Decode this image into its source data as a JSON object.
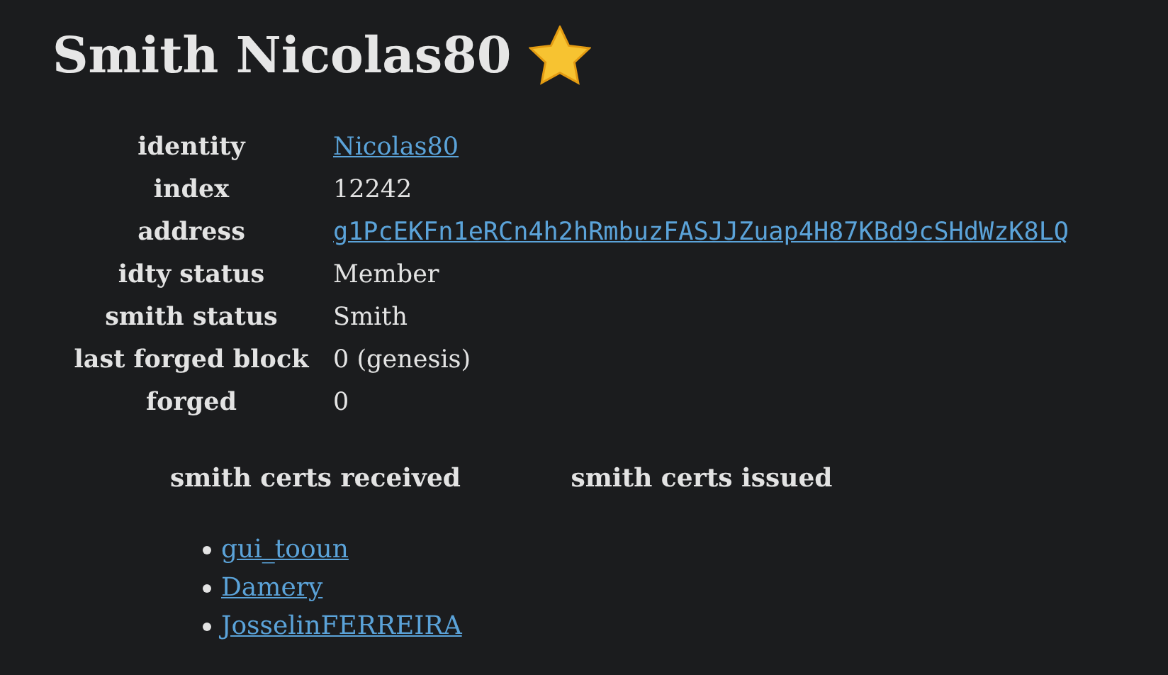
{
  "title": "Smith Nicolas80",
  "fields": [
    {
      "label": "identity",
      "value": "Nicolas80",
      "kind": "link"
    },
    {
      "label": "index",
      "value": "12242",
      "kind": "text"
    },
    {
      "label": "address",
      "value": "g1PcEKFn1eRCn4h2hRmbuzFASJJZuap4H87KBd9cSHdWzK8LQ",
      "kind": "mono-link"
    },
    {
      "label": "idty status",
      "value": "Member",
      "kind": "text"
    },
    {
      "label": "smith status",
      "value": "Smith",
      "kind": "text"
    },
    {
      "label": "last forged block",
      "value": "0 (genesis)",
      "kind": "text"
    },
    {
      "label": "forged",
      "value": "0",
      "kind": "text"
    }
  ],
  "certs": {
    "received_heading": "smith certs received",
    "issued_heading": "smith certs issued",
    "received": [
      "gui_tooun",
      "Damery",
      "JosselinFERREIRA"
    ]
  }
}
